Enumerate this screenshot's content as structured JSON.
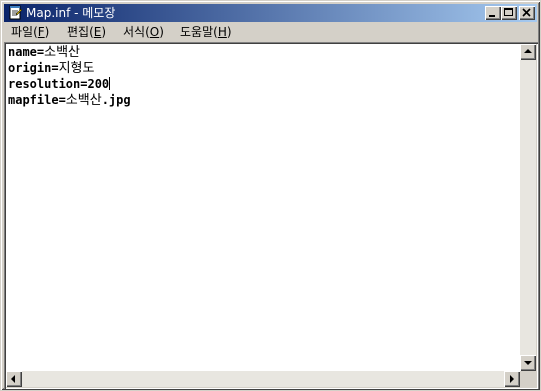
{
  "window": {
    "title": "Map.inf - 메모장",
    "icon": "notepad-icon",
    "controls": {
      "minimize": "minimize-icon",
      "maximize": "maximize-icon",
      "close": "close-icon"
    }
  },
  "menubar": {
    "items": [
      {
        "label": "파일(",
        "accel": "F",
        "end": ")"
      },
      {
        "label": "편집(",
        "accel": "E",
        "end": ")"
      },
      {
        "label": "서식(",
        "accel": "O",
        "end": ")"
      },
      {
        "label": "도움말(",
        "accel": "H",
        "end": ")"
      }
    ]
  },
  "document": {
    "lines": [
      {
        "key": "name=",
        "value": "소백산"
      },
      {
        "key": "origin=",
        "value": "지형도"
      },
      {
        "key": "resolution=200",
        "value": ""
      },
      {
        "key": "mapfile=",
        "value": "소백산",
        "suffix": ".jpg"
      }
    ]
  },
  "colors": {
    "titlebar_start": "#0a246a",
    "titlebar_end": "#a6caf0",
    "face": "#d4d0c8"
  }
}
